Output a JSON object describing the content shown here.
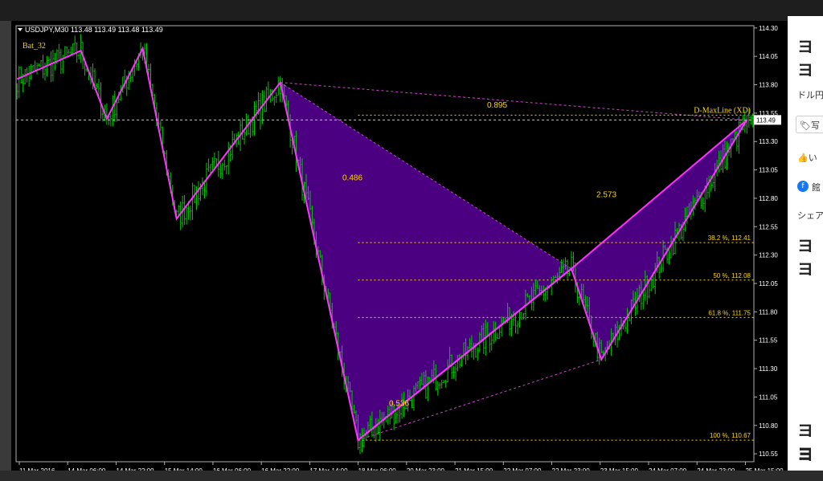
{
  "window": {
    "symbol_header": "USDJPY,M30  113.48 113.49 113.48 113.49",
    "indicator_name": "Bat_32",
    "current_price": "113.49"
  },
  "colors": {
    "background": "#000000",
    "candles": "#00c800",
    "pattern_fill": "#4b0082",
    "pattern_edge": "#ff33ff",
    "annotation": "#ffd700",
    "level_line": "#ffd700",
    "dotted_magenta": "#cc44cc",
    "axis_text": "#ffffff"
  },
  "chart_data": {
    "type": "candlestick",
    "y_ticks": [
      "114.30",
      "114.05",
      "113.80",
      "113.55",
      "113.30",
      "113.05",
      "112.80",
      "112.55",
      "112.30",
      "112.05",
      "111.80",
      "111.55",
      "111.30",
      "111.05",
      "110.80",
      "110.55"
    ],
    "ylim": [
      110.48,
      114.32
    ],
    "x_ticks": [
      "11 Mar 2016",
      "14 Mar 06:00",
      "14 Mar 22:00",
      "15 Mar 14:00",
      "16 Mar 06:00",
      "16 Mar 22:00",
      "17 Mar 14:00",
      "18 Mar 06:00",
      "20 Mar 23:00",
      "21 Mar 15:00",
      "22 Mar 07:00",
      "22 Mar 23:00",
      "23 Mar 15:00",
      "24 Mar 07:00",
      "24 Mar 23:00",
      "25 Mar 15:00"
    ],
    "bars_count": 370,
    "pattern_points": [
      {
        "bar": 0,
        "price": 113.85
      },
      {
        "bar": 32,
        "price": 114.1
      },
      {
        "bar": 45,
        "price": 113.5
      },
      {
        "bar": 63,
        "price": 114.12
      },
      {
        "bar": 80,
        "price": 112.62
      },
      {
        "bar": 132,
        "price": 113.82
      },
      {
        "bar": 171,
        "price": 110.67
      },
      {
        "bar": 278,
        "price": 112.18
      },
      {
        "bar": 293,
        "price": 111.38
      },
      {
        "bar": 366,
        "price": 113.49
      }
    ],
    "ratios": [
      {
        "label": "0.895",
        "bar": 290,
        "price": 113.6
      },
      {
        "label": "0.486",
        "bar": 202,
        "price": 112.96
      },
      {
        "label": "0.536",
        "bar": 232,
        "price": 110.97
      },
      {
        "label": "2.573",
        "bar": 364,
        "price": 112.81
      }
    ],
    "d_label": "D-MaxLine (XD)",
    "d_level_price": 113.49,
    "levels": [
      {
        "label": "38.2 %,  112.41",
        "price": 112.41
      },
      {
        "label": "50 %,  112.08",
        "price": 112.08
      },
      {
        "label": "61.8 %,  111.75",
        "price": 111.75
      },
      {
        "label": "100 %,  110.67",
        "price": 110.67
      }
    ]
  },
  "web_panel": {
    "logo": "ヨヨ",
    "text1": "ドル円",
    "tag": "写",
    "like": "い",
    "fb_label": "館",
    "share": "シェア"
  }
}
